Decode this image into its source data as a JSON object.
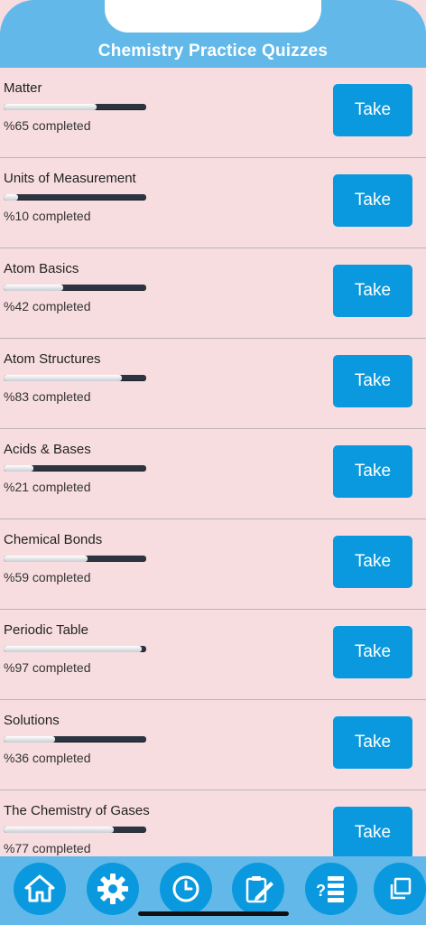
{
  "header": {
    "title": "Chemistry Practice Quizzes"
  },
  "quizzes": [
    {
      "title": "Matter",
      "progress": 0.65,
      "status": "%65 completed",
      "button": "Take"
    },
    {
      "title": "Units of Measurement",
      "progress": 0.1,
      "status": "%10 completed",
      "button": "Take"
    },
    {
      "title": "Atom Basics",
      "progress": 0.42,
      "status": "%42 completed",
      "button": "Take"
    },
    {
      "title": "Atom Structures",
      "progress": 0.83,
      "status": "%83 completed",
      "button": "Take"
    },
    {
      "title": "Acids & Bases",
      "progress": 0.21,
      "status": "%21 completed",
      "button": "Take"
    },
    {
      "title": "Chemical Bonds",
      "progress": 0.59,
      "status": "%59 completed",
      "button": "Take"
    },
    {
      "title": "Periodic Table",
      "progress": 0.97,
      "status": "%97 completed",
      "button": "Take"
    },
    {
      "title": "Solutions",
      "progress": 0.36,
      "status": "%36 completed",
      "button": "Take"
    },
    {
      "title": "The Chemistry of Gases",
      "progress": 0.77,
      "status": "%77 completed",
      "button": "Take"
    }
  ],
  "tabbar": {
    "icons": [
      "home-icon",
      "gear-icon",
      "clock-icon",
      "edit-icon",
      "quiz-list-icon",
      "copy-icon"
    ]
  },
  "colors": {
    "header": "#62b9e9",
    "button": "#0a99de",
    "background": "#f7dde0",
    "progress_track": "#2d3441"
  }
}
